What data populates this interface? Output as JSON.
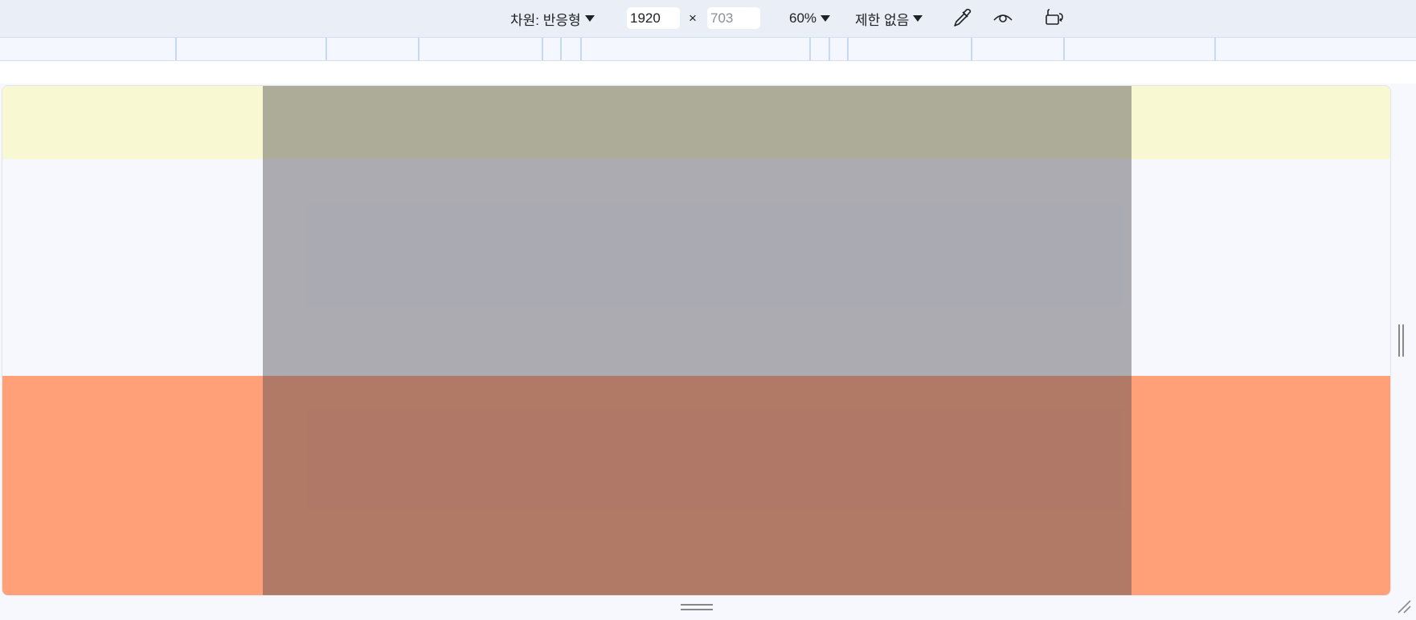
{
  "toolbar": {
    "dimensions_label": "차원: 반응형",
    "width_value": "1920",
    "times_symbol": "×",
    "height_placeholder": "703",
    "zoom_label": "60%",
    "throttle_label": "제한 없음",
    "icons": [
      "eyedropper-icon",
      "eye-icon",
      "rotate-device-icon"
    ]
  },
  "viewport": {
    "colors": {
      "top_band": "#f8f9d3",
      "middle_band": "#f6f8fe",
      "bottom_band": "#ffa079",
      "overlay": "rgba(74,72,80,0.44)"
    }
  }
}
